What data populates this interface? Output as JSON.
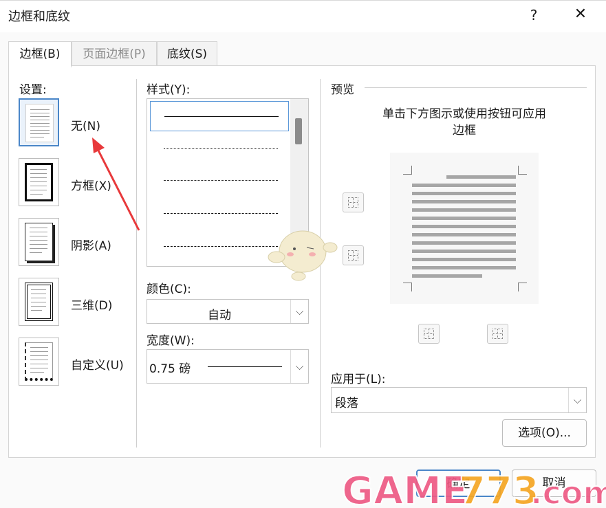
{
  "window": {
    "title": "边框和底纹",
    "help": "?",
    "close": "✕"
  },
  "tabs": [
    {
      "label": "边框(B)"
    },
    {
      "label": "页面边框(P)"
    },
    {
      "label": "底纹(S)"
    }
  ],
  "settings": {
    "heading": "设置:",
    "items": [
      {
        "label": "无(N)"
      },
      {
        "label": "方框(X)"
      },
      {
        "label": "阴影(A)"
      },
      {
        "label": "三维(D)"
      },
      {
        "label": "自定义(U)"
      }
    ]
  },
  "style": {
    "heading": "样式(Y):"
  },
  "color": {
    "heading": "颜色(C):",
    "value": "自动"
  },
  "width": {
    "heading": "宽度(W):",
    "value": "0.75 磅"
  },
  "preview": {
    "heading": "预览",
    "instruction_line1": "单击下方图示或使用按钮可应用",
    "instruction_line2": "边框"
  },
  "apply": {
    "heading": "应用于(L):",
    "value": "段落"
  },
  "buttons": {
    "options": "选项(O)...",
    "ok": "确定",
    "cancel": "取消"
  },
  "icons": {
    "dropdown": "⌵",
    "arrow_color": "#e8393b"
  }
}
